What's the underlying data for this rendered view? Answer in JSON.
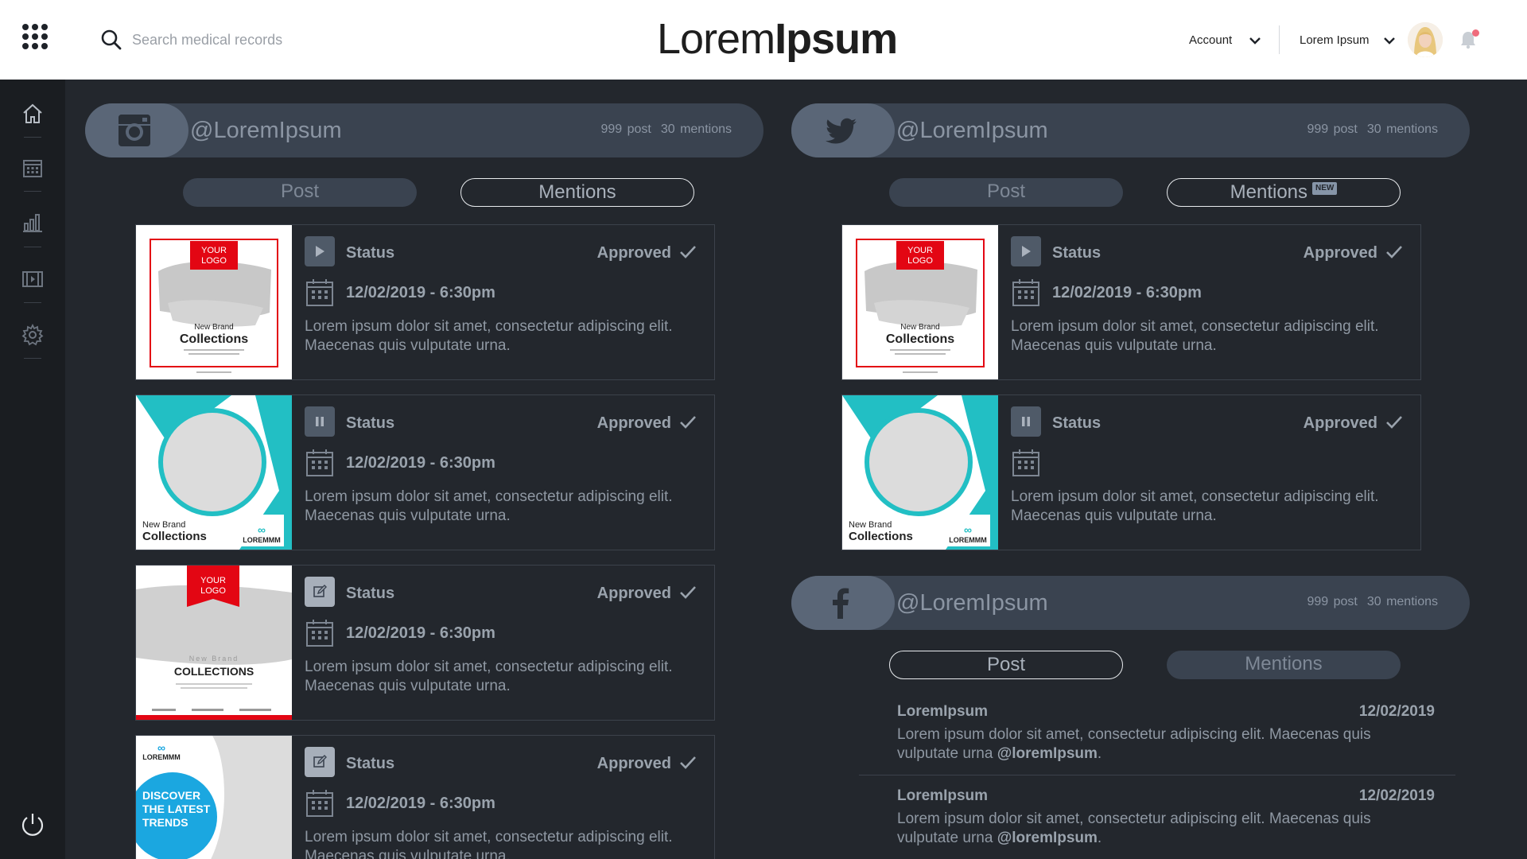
{
  "header": {
    "search_placeholder": "Search medical records",
    "logo_light": "Lorem",
    "logo_bold": "Ipsum",
    "account_label": "Account",
    "user_label": "Lorem Ipsum"
  },
  "sidebar": {
    "items": [
      "home-icon",
      "calendar-icon",
      "bar-chart-icon",
      "film-icon",
      "gear-icon"
    ],
    "power": "power-icon"
  },
  "accounts": [
    {
      "network": "instagram",
      "handle": "@LoremIpsum",
      "posts": "999 post",
      "mentions": "30 mentions",
      "tab_post": "Post",
      "tab_mentions": "Mentions",
      "active_tab": "post",
      "cards": [
        {
          "thumb": "your-logo-red",
          "control": "play-icon",
          "status": "Status",
          "approval": "Approved",
          "datetime": "12/02/2019 - 6:30pm",
          "text": "Lorem ipsum dolor sit amet, consectetur adipiscing elit. Maecenas quis vulputate urna."
        },
        {
          "thumb": "teal-circle",
          "control": "pause-icon",
          "status": "Status",
          "approval": "Approved",
          "datetime": "12/02/2019 - 6:30pm",
          "text": "Lorem ipsum dolor sit amet, consectetur adipiscing elit. Maecenas quis vulputate urna."
        },
        {
          "thumb": "your-logo-ribbon",
          "control": "edit-icon",
          "status": "Status",
          "approval": "Approved",
          "datetime": "12/02/2019 - 6:30pm",
          "text": "Lorem ipsum dolor sit amet, consectetur adipiscing elit. Maecenas quis vulputate urna."
        },
        {
          "thumb": "discover-blue",
          "control": "edit-icon",
          "status": "Status",
          "approval": "Approved",
          "datetime": "12/02/2019 - 6:30pm",
          "text": "Lorem ipsum dolor sit amet, consectetur adipiscing elit. Maecenas quis vulputate urna."
        }
      ]
    },
    {
      "network": "twitter",
      "handle": "@LoremIpsum",
      "posts": "999 post",
      "mentions": "30 mentions",
      "tab_post": "Post",
      "tab_mentions": "Mentions",
      "mentions_badge": "NEW",
      "active_tab": "mentions",
      "cards": [
        {
          "thumb": "your-logo-red",
          "control": "play-icon",
          "status": "Status",
          "approval": "Approved",
          "datetime": "12/02/2019 - 6:30pm",
          "text": "Lorem ipsum dolor sit amet, consectetur adipiscing elit. Maecenas quis vulputate urna."
        },
        {
          "thumb": "teal-circle",
          "control": "pause-icon",
          "status": "Status",
          "approval": "Approved",
          "datetime": "",
          "text": "Lorem ipsum dolor sit amet, consectetur adipiscing elit. Maecenas quis vulputate urna."
        }
      ]
    },
    {
      "network": "facebook",
      "handle": "@LoremIpsum",
      "posts": "999 post",
      "mentions": "30 mentions",
      "tab_post": "Post",
      "tab_mentions": "Mentions",
      "active_tab": "post",
      "mention_items": [
        {
          "user": "LoremIpsum",
          "date": "12/02/2019",
          "text": "Lorem ipsum dolor sit amet, consectetur adipiscing elit. Maecenas quis vulputate urna ",
          "tag": "@loremIpsum",
          "end": "."
        },
        {
          "user": "LoremIpsum",
          "date": "12/02/2019",
          "text": "Lorem ipsum dolor sit amet, consectetur adipiscing elit. Maecenas quis vulputate urna ",
          "tag": "@loremIpsum",
          "end": "."
        }
      ]
    }
  ],
  "thumb_text": {
    "your_logo_1": "YOUR",
    "your_logo_2": "LOGO",
    "new_brand": "New Brand",
    "collections": "Collections",
    "collections_caps": "COLLECTIONS",
    "loremmm": "LOREMMM",
    "discover_1": "DISCOVER",
    "discover_2": "THE LATEST",
    "discover_3": "TRENDS"
  },
  "colors": {
    "background": "#23272d",
    "sidebar": "#1a1d21",
    "pill": "#3a4350",
    "pill_cap": "#5a6677",
    "brand_red": "#e30613",
    "teal": "#22bfc4",
    "blue": "#1ba7e0",
    "notification_dot": "#ef6b7c"
  }
}
